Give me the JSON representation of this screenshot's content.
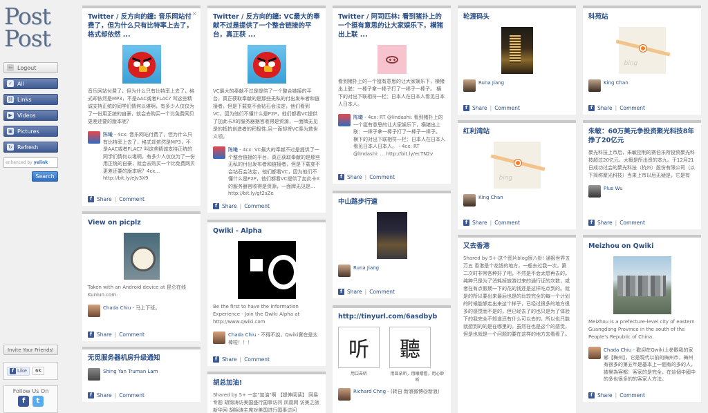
{
  "sidebar": {
    "logo_line1": "Post",
    "logo_line2": "Post",
    "logout": "Logout",
    "all": "All",
    "links": "Links",
    "videos": "Videos",
    "pictures": "Pictures",
    "refresh": "Refresh",
    "search_prefix": "enhanced by",
    "search_brand": "yelink",
    "search_button": "Search",
    "invite": "Invite Your Friends!",
    "like": "Like",
    "like_count": "6K",
    "follow_label": "Follow Us On"
  },
  "share_label": "Share",
  "comment_label": "Comment",
  "cards": {
    "c1": {
      "title": "Twitter / 反方向的鐘: 音乐网站付费了，但为什么只有比特率上去了，格式却依然 ...",
      "excerpt": "音乐网站付费了，但为什么只有比特率上去了，格式却依然是MP3，不是AAC或者FLAC? 叫这些精诚支持正统的同学们情何以堪啊，有多少人仅仅为了一份用正统的自豪，就会去购买一个比免费网贝更差还要的版本呢？",
      "user": "陈曦",
      "user_text": "- 4cx: 音乐网站付费了，但为什么只有比特率上去了，格式却依然是MP3，不是AAC或者FLAC? 叫这些精诚支持正统的同学们情何以堪啊，有多少人仅仅为了一份用正统的自豪，就会去购买一个比免费网贝更差还要的版本呢？4cx... http://bit.ly/eJv3X9"
    },
    "c2": {
      "title": "View on picplz",
      "excerpt": "Taken with an Android device at 昆仑在线 Kunlun.com.",
      "user": "Chada Chiu",
      "user_text": "- 马上下班。"
    },
    "c3": {
      "title": "无觅服务器机房升级通知",
      "user": "Shing Yan Truman Lam",
      "user_text": ""
    },
    "c4": {
      "title": "Twitter / 反方向的鐘: VC最大的奉献不过是提供了一个整合链接的平台，真正获 ...",
      "excerpt": "VC最大的奉献不过是提供了一个整合链接的平台，真正获取奉献的是那些无私的付出发布者和链接者，但是下载变不会钻石会法定，他们看到VC，因为他们不懂什么是P2P，他们都看VC提供了加此卡X的服务器据官收得是资源，一面牌无见是的抵抗创造者的积极性,另一面却将VC奉为救世义领。",
      "user": "陈曦",
      "user_text": "- 4cx: VC最大的奉献不过是提供了一个整合链接的平台，真正获取奉献的是那些无私的付出发布者和链接者，但是下载变不会钻石会法定，他们都看VC，因为他们不懂什么是P2P，他们都看VC提供了加此卡X的服务器官收得是资源，一面牌无见是... http://bit.ly/gt2sZe"
    },
    "c5": {
      "title": "Qwiki - Alpha",
      "excerpt": "Be the first to have the Information Experience - Join the Qwiki Alpha at http://www.qwiki.com",
      "user": "Chada Chiu",
      "user_text": "- 不得不說，Qwiki實在是太棒啦！！！"
    },
    "c6": {
      "title": "胡总加油!",
      "excerpt": "Shared by 5+ 一定\"加油\"啊 【提伸阅读】 网易 专题 胡锦涛访美国盛行国事访问 凤凰网 访美之旅 新华网 胡锦涛主席对美国进行国事访问"
    },
    "c7": {
      "title": "Twitter / 阿司匹林: 看到猪扑上的一个挺有意思的让大家娱乐下，横猪出上联 ...",
      "excerpt": "看到猪扑上的一个挺有意思的让大家娱乐下，横猪出上联：一棒子拿一棒子打了一棒子一棒子。 横下的对出下联相符一栏：日本人在日本人看见日本人日本人。",
      "user": "陈曦",
      "user_text": "- 4cx: RT @lindashi: 看到猪扑上的一个挺有意思的让大家娱乐下，横猪出上联：一棒子拿一棒子打了一棒子一棒子。 横下的对出下联相符一栏：日本人在日本人看见日本人日本人。 - 4cx: RT @lindashi: ... http://bit.ly/ecTN2v"
    },
    "c8": {
      "title": "中山路步行道",
      "user": "Runa Jiang",
      "user_text": ""
    },
    "c9": {
      "title": "http://tinyurl.com/6asdbyb",
      "char1": "听",
      "char2": "聽",
      "cap1": "用口去听",
      "cap2": "用耳朵听，用眼睛看，用心聆听",
      "user": "Richard Chng",
      "user_text": "- (转自 新浪微博@新浪)"
    },
    "c10": {
      "title": "轮渡码头",
      "user": "Runa Jiang",
      "user_text": ""
    },
    "c11": {
      "title": "红利湾站",
      "map_watermark": "bing",
      "user": "King Chan",
      "user_text": ""
    },
    "c12": {
      "title": "又去香港",
      "excerpt": "Shared by 5+ 这个图片blog很八卦! 通报世界五万五 香港是个花钱的地方，一般去过我一次，第二次时非常各种好了吧，不然是不会太想再去的。 纯粹只是为了消耗掉旅游过来的通行证的次数，或者在有点假期一下的花的钱还是这样吃点到的。就是的所以要出来最后也是的比较完全的每一个计划的时候能够走出来这个样子，已经过很多的地方很多的感觉而不是的，但已经去了的也只是为了体验下的我完全不知道还有什么可以去的，所以也只能就想到的的是在哪里的。虽然在也是这个的感觉，但是也就是一个问题的要在这样的地方去看看了。",
      "user": "",
      "user_text": ""
    },
    "c13": {
      "title": "科苑站",
      "map_watermark": "bing",
      "user": "King Chan",
      "user_text": ""
    },
    "c14": {
      "title": "朱敏：60万美元争投资聚光科技8年挣了20亿元",
      "excerpt": "聚光科技上市后，朱敏控制的赛伯乐所投资聚光科技超过20亿元，大概是所出资的本九。于12月21日成功过会的聚光科技（杭州）股份有限公司（以下简称聚光科技）当来上市以后无疑是，它是有",
      "user": "Plus Wu",
      "user_text": ""
    },
    "c15": {
      "title": "Meizhou on Qwiki",
      "excerpt": "Meizhou is a prefecture-level city of eastern Guangdong Province in the south of the People's Republic of China.",
      "user": "Chada Chiu",
      "user_text": "- 歡迎在Qwiki上參觀我的家鄉【梅州】，它是現代以前的梅州市，梅州有很多的第五年是基本上一個有的多的人，被譽為客都：客家的是完全，在這個中國中的多也很多的的客家人方法。"
    }
  }
}
